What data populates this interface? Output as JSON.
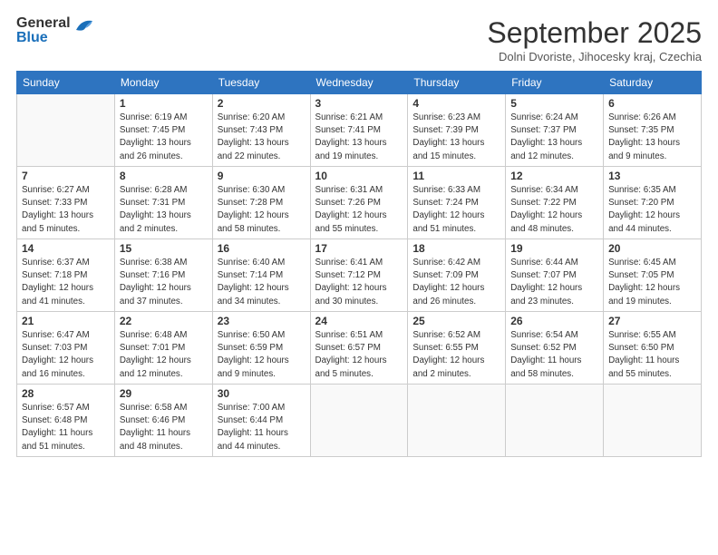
{
  "header": {
    "logo_line1": "General",
    "logo_line2": "Blue",
    "title": "September 2025",
    "location": "Dolni Dvoriste, Jihocesky kraj, Czechia"
  },
  "days_of_week": [
    "Sunday",
    "Monday",
    "Tuesday",
    "Wednesday",
    "Thursday",
    "Friday",
    "Saturday"
  ],
  "weeks": [
    [
      {
        "day": "",
        "info": ""
      },
      {
        "day": "1",
        "info": "Sunrise: 6:19 AM\nSunset: 7:45 PM\nDaylight: 13 hours\nand 26 minutes."
      },
      {
        "day": "2",
        "info": "Sunrise: 6:20 AM\nSunset: 7:43 PM\nDaylight: 13 hours\nand 22 minutes."
      },
      {
        "day": "3",
        "info": "Sunrise: 6:21 AM\nSunset: 7:41 PM\nDaylight: 13 hours\nand 19 minutes."
      },
      {
        "day": "4",
        "info": "Sunrise: 6:23 AM\nSunset: 7:39 PM\nDaylight: 13 hours\nand 15 minutes."
      },
      {
        "day": "5",
        "info": "Sunrise: 6:24 AM\nSunset: 7:37 PM\nDaylight: 13 hours\nand 12 minutes."
      },
      {
        "day": "6",
        "info": "Sunrise: 6:26 AM\nSunset: 7:35 PM\nDaylight: 13 hours\nand 9 minutes."
      }
    ],
    [
      {
        "day": "7",
        "info": "Sunrise: 6:27 AM\nSunset: 7:33 PM\nDaylight: 13 hours\nand 5 minutes."
      },
      {
        "day": "8",
        "info": "Sunrise: 6:28 AM\nSunset: 7:31 PM\nDaylight: 13 hours\nand 2 minutes."
      },
      {
        "day": "9",
        "info": "Sunrise: 6:30 AM\nSunset: 7:28 PM\nDaylight: 12 hours\nand 58 minutes."
      },
      {
        "day": "10",
        "info": "Sunrise: 6:31 AM\nSunset: 7:26 PM\nDaylight: 12 hours\nand 55 minutes."
      },
      {
        "day": "11",
        "info": "Sunrise: 6:33 AM\nSunset: 7:24 PM\nDaylight: 12 hours\nand 51 minutes."
      },
      {
        "day": "12",
        "info": "Sunrise: 6:34 AM\nSunset: 7:22 PM\nDaylight: 12 hours\nand 48 minutes."
      },
      {
        "day": "13",
        "info": "Sunrise: 6:35 AM\nSunset: 7:20 PM\nDaylight: 12 hours\nand 44 minutes."
      }
    ],
    [
      {
        "day": "14",
        "info": "Sunrise: 6:37 AM\nSunset: 7:18 PM\nDaylight: 12 hours\nand 41 minutes."
      },
      {
        "day": "15",
        "info": "Sunrise: 6:38 AM\nSunset: 7:16 PM\nDaylight: 12 hours\nand 37 minutes."
      },
      {
        "day": "16",
        "info": "Sunrise: 6:40 AM\nSunset: 7:14 PM\nDaylight: 12 hours\nand 34 minutes."
      },
      {
        "day": "17",
        "info": "Sunrise: 6:41 AM\nSunset: 7:12 PM\nDaylight: 12 hours\nand 30 minutes."
      },
      {
        "day": "18",
        "info": "Sunrise: 6:42 AM\nSunset: 7:09 PM\nDaylight: 12 hours\nand 26 minutes."
      },
      {
        "day": "19",
        "info": "Sunrise: 6:44 AM\nSunset: 7:07 PM\nDaylight: 12 hours\nand 23 minutes."
      },
      {
        "day": "20",
        "info": "Sunrise: 6:45 AM\nSunset: 7:05 PM\nDaylight: 12 hours\nand 19 minutes."
      }
    ],
    [
      {
        "day": "21",
        "info": "Sunrise: 6:47 AM\nSunset: 7:03 PM\nDaylight: 12 hours\nand 16 minutes."
      },
      {
        "day": "22",
        "info": "Sunrise: 6:48 AM\nSunset: 7:01 PM\nDaylight: 12 hours\nand 12 minutes."
      },
      {
        "day": "23",
        "info": "Sunrise: 6:50 AM\nSunset: 6:59 PM\nDaylight: 12 hours\nand 9 minutes."
      },
      {
        "day": "24",
        "info": "Sunrise: 6:51 AM\nSunset: 6:57 PM\nDaylight: 12 hours\nand 5 minutes."
      },
      {
        "day": "25",
        "info": "Sunrise: 6:52 AM\nSunset: 6:55 PM\nDaylight: 12 hours\nand 2 minutes."
      },
      {
        "day": "26",
        "info": "Sunrise: 6:54 AM\nSunset: 6:52 PM\nDaylight: 11 hours\nand 58 minutes."
      },
      {
        "day": "27",
        "info": "Sunrise: 6:55 AM\nSunset: 6:50 PM\nDaylight: 11 hours\nand 55 minutes."
      }
    ],
    [
      {
        "day": "28",
        "info": "Sunrise: 6:57 AM\nSunset: 6:48 PM\nDaylight: 11 hours\nand 51 minutes."
      },
      {
        "day": "29",
        "info": "Sunrise: 6:58 AM\nSunset: 6:46 PM\nDaylight: 11 hours\nand 48 minutes."
      },
      {
        "day": "30",
        "info": "Sunrise: 7:00 AM\nSunset: 6:44 PM\nDaylight: 11 hours\nand 44 minutes."
      },
      {
        "day": "",
        "info": ""
      },
      {
        "day": "",
        "info": ""
      },
      {
        "day": "",
        "info": ""
      },
      {
        "day": "",
        "info": ""
      }
    ]
  ]
}
